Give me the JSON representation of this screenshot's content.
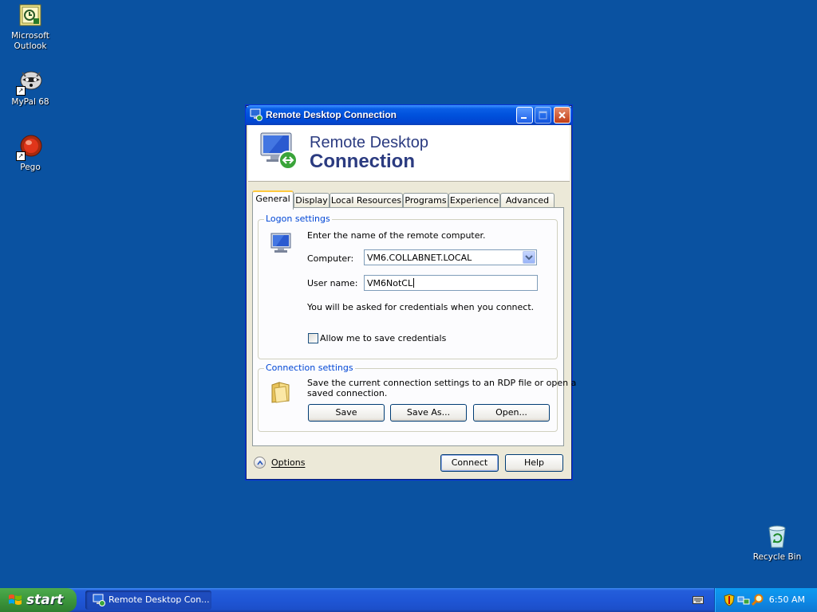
{
  "desktop": {
    "icons": [
      {
        "label": "Microsoft Outlook",
        "icon": "outlook-icon"
      },
      {
        "label": "MyPal 68",
        "icon": "mypal-icon"
      },
      {
        "label": "Pego",
        "icon": "pego-icon"
      },
      {
        "label": "Recycle Bin",
        "icon": "recycle-bin-icon"
      }
    ]
  },
  "window": {
    "title": "Remote Desktop Connection",
    "banner_line1": "Remote Desktop",
    "banner_line2": "Connection",
    "tabs": [
      "General",
      "Display",
      "Local Resources",
      "Programs",
      "Experience",
      "Advanced"
    ],
    "active_tab": "General",
    "logon": {
      "legend": "Logon settings",
      "intro": "Enter the name of the remote computer.",
      "computer_label": "Computer:",
      "computer_value": "VM6.COLLABNET.LOCAL",
      "username_label": "User name:",
      "username_value": "VM6NotCL",
      "credentials_note": "You will be asked for credentials when you connect.",
      "save_credentials_label": "Allow me to save credentials",
      "save_credentials_checked": false
    },
    "connection": {
      "legend": "Connection settings",
      "description_line1": "Save the current connection settings to an RDP file or open a",
      "description_line2": "saved connection.",
      "save_button": "Save",
      "save_as_button": "Save As...",
      "open_button": "Open..."
    },
    "footer": {
      "options_label": "Options",
      "connect_button": "Connect",
      "help_button": "Help"
    }
  },
  "taskbar": {
    "start_label": "start",
    "task_item": "Remote Desktop Con...",
    "clock": "6:50 AM"
  },
  "colors": {
    "desktop": "#0a52a1",
    "titlebar": "#0051dc",
    "window_body": "#ece9d8",
    "legend_blue": "#0046d5",
    "banner_text": "#2b3b80",
    "start_green": "#3c963c"
  }
}
